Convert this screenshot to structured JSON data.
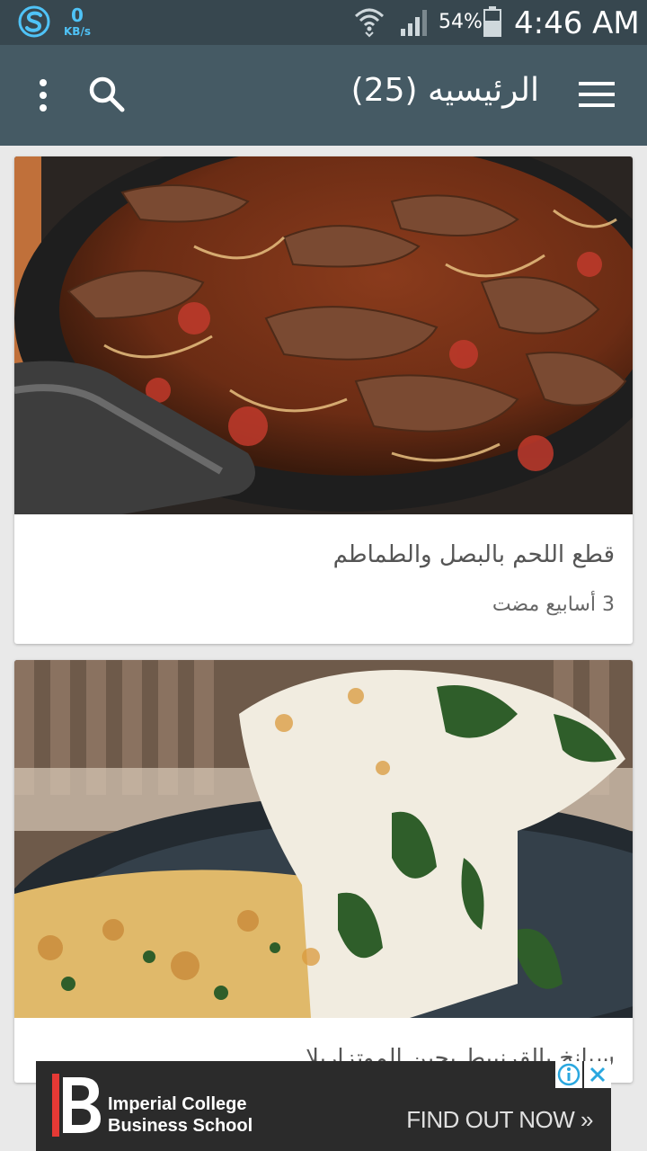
{
  "status_bar": {
    "net_speed_value": "0",
    "net_speed_unit": "KB/s",
    "battery_percent": "54%",
    "time": "4:46 AM"
  },
  "app_bar": {
    "title": "الرئيسيه (25)"
  },
  "cards": [
    {
      "title": "قطع اللحم بالبصل والطماطم",
      "time_ago": "3 أسابيع مضت",
      "image": "beef-onion-tomato-skillet"
    },
    {
      "title": "سبانخ بالقرنبيط بجبن الموتزاريلا",
      "image": "spinach-cheese-casserole"
    }
  ],
  "ad": {
    "brand_line1": "Imperial College",
    "brand_line2": "Business School",
    "cta": "FIND OUT NOW",
    "icons": [
      "info-icon",
      "close-icon"
    ]
  },
  "colors": {
    "status_bar": "#37474f",
    "app_bar": "#455a64",
    "background": "#e9e9e9",
    "net_speed": "#4fc3f7"
  }
}
